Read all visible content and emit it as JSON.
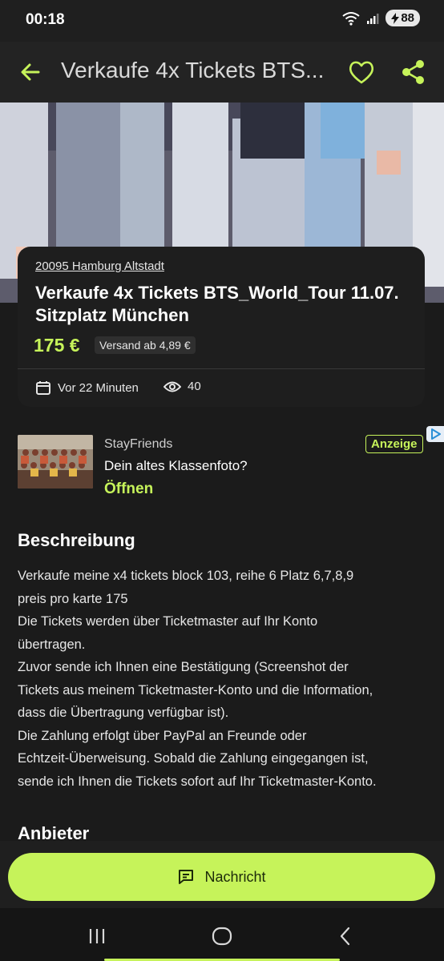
{
  "status_bar": {
    "time": "00:18",
    "battery": "88"
  },
  "header": {
    "title": "Verkaufe 4x Tickets BTS..."
  },
  "listing": {
    "location": "20095 Hamburg Altstadt",
    "title": "Verkaufe 4x Tickets BTS_World_Tour 11.07. Sitzplatz München",
    "price": "175 €",
    "shipping": "Versand ab 4,89 €",
    "posted": "Vor 22 Minuten",
    "views": "40"
  },
  "ad": {
    "brand": "StayFriends",
    "headline": "Dein altes Klassenfoto?",
    "cta": "Öffnen",
    "badge": "Anzeige"
  },
  "description": {
    "heading": "Beschreibung",
    "lines": [
      "Verkaufe meine x4 tickets block 103, reihe 6 Platz 6,7,8,9",
      "preis pro karte 175",
      "Die Tickets werden über Ticketmaster auf Ihr Konto",
      "übertragen.",
      "Zuvor sende ich Ihnen eine Bestätigung (Screenshot der",
      "Tickets aus meinem Ticketmaster-Konto und die Information,",
      "dass die Übertragung verfügbar ist).",
      "Die Zahlung erfolgt über PayPal an Freunde oder",
      "Echtzeit-Überweisung. Sobald die Zahlung eingegangen ist,",
      "sende ich Ihnen die Tickets sofort auf Ihr Ticketmaster-Konto."
    ]
  },
  "provider": {
    "heading": "Anbieter"
  },
  "actions": {
    "message_label": "Nachricht"
  },
  "colors": {
    "accent": "#c6f35a",
    "background": "#1b1b1b",
    "card": "#1e1e1e"
  },
  "icons": {
    "back": "arrow-left-icon",
    "favorite": "heart-icon",
    "share": "share-icon",
    "calendar": "calendar-icon",
    "views": "eye-icon",
    "message": "message-icon"
  }
}
